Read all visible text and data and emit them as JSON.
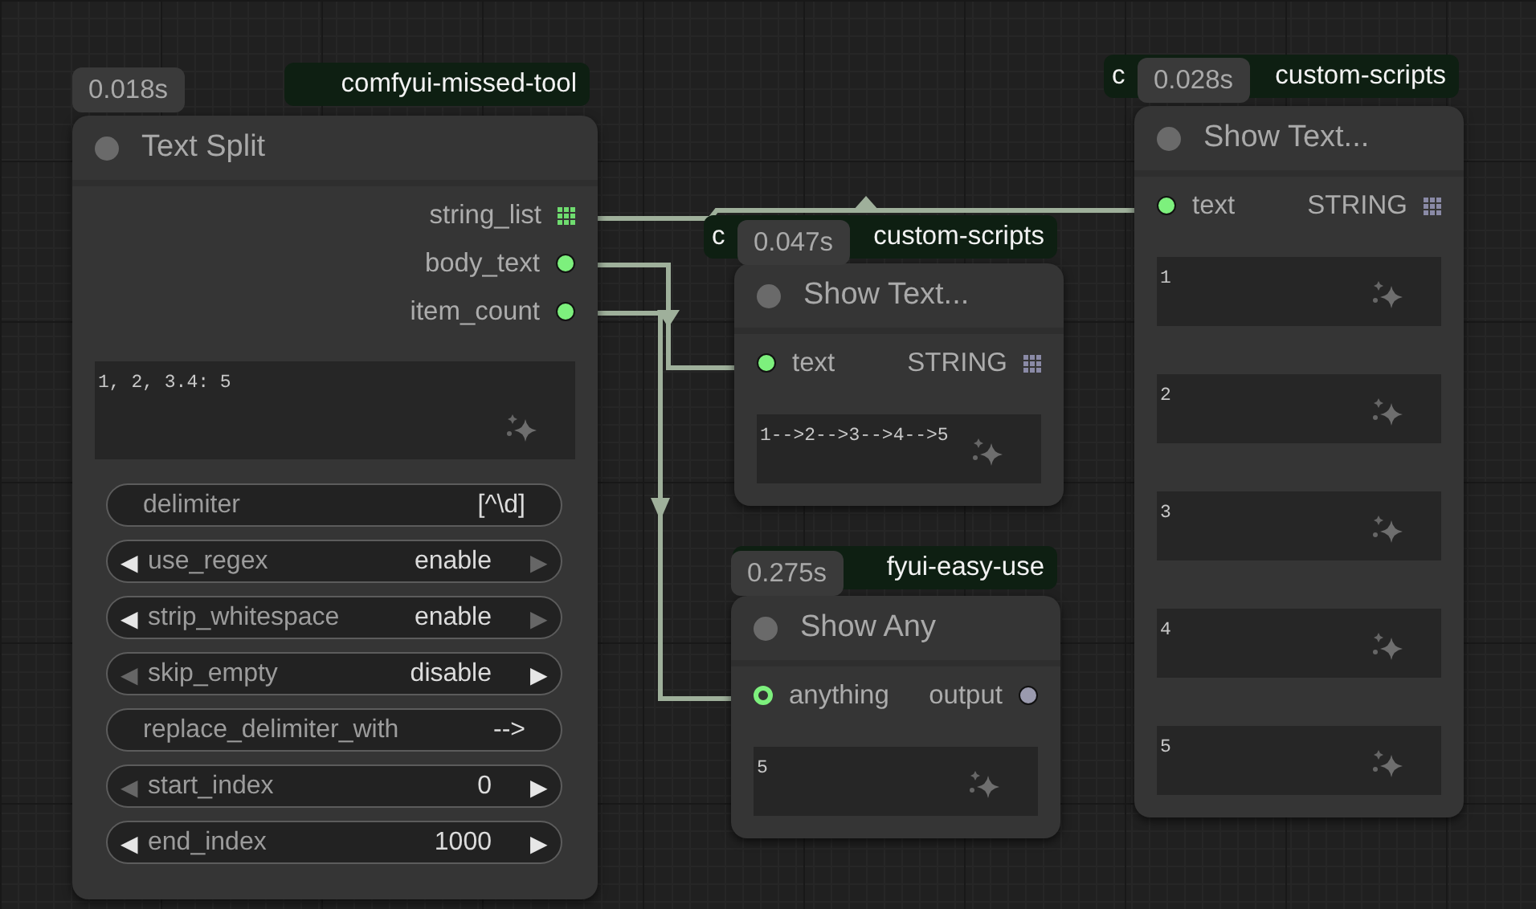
{
  "nodes": [
    {
      "title": "Text Split",
      "time": "0.018s",
      "source": [
        "comfyui-missed-tool"
      ],
      "outputs": [
        {
          "label": "string_list",
          "kind": "grid",
          "color": "#6fdc6f"
        },
        {
          "label": "body_text",
          "kind": "dot",
          "color": "#7df07d"
        },
        {
          "label": "item_count",
          "kind": "dot",
          "color": "#7df07d"
        }
      ],
      "textareas": [
        "1, 2, 3.4: 5"
      ],
      "widgets": [
        {
          "kind": "text",
          "label": "delimiter",
          "value": "[^\\d]"
        },
        {
          "kind": "combo",
          "label": "use_regex",
          "value": "enable",
          "prev": "◀",
          "next": "▶",
          "prev_enabled": true,
          "next_enabled": false
        },
        {
          "kind": "combo",
          "label": "strip_whitespace",
          "value": "enable",
          "prev": "◀",
          "next": "▶",
          "prev_enabled": true,
          "next_enabled": false
        },
        {
          "kind": "combo",
          "label": "skip_empty",
          "value": "disable",
          "prev": "◀",
          "next": "▶",
          "prev_enabled": false,
          "next_enabled": true
        },
        {
          "kind": "text",
          "label": "replace_delimiter_with",
          "value": "-->"
        },
        {
          "kind": "combo",
          "label": "start_index",
          "value": "0",
          "prev": "◀",
          "next": "▶",
          "prev_enabled": false,
          "next_enabled": true
        },
        {
          "kind": "combo",
          "label": "end_index",
          "value": "1000",
          "prev": "◀",
          "next": "▶",
          "prev_enabled": true,
          "next_enabled": true
        }
      ]
    },
    {
      "title": "Show Text...",
      "time": "0.047s",
      "source": [
        "c",
        "custom-scripts"
      ],
      "inputs": [
        {
          "label": "text",
          "kind": "dot",
          "color": "#7df07d"
        }
      ],
      "outputs": [
        {
          "label": "STRING",
          "kind": "grid",
          "color": "#8a8aa6"
        }
      ],
      "textareas": [
        "1-->2-->3-->4-->5"
      ]
    },
    {
      "title": "Show Any",
      "time": "0.275s",
      "source": [
        "fyui-easy-use"
      ],
      "inputs": [
        {
          "label": "anything",
          "kind": "ring",
          "color": "#7df07d"
        }
      ],
      "outputs": [
        {
          "label": "output",
          "kind": "dot",
          "color": "#9a9aae"
        }
      ],
      "textareas": [
        "5"
      ]
    },
    {
      "title": "Show Text...",
      "time": "0.028s",
      "source": [
        "c",
        "custom-scripts"
      ],
      "inputs": [
        {
          "label": "text",
          "kind": "dot",
          "color": "#7df07d"
        }
      ],
      "outputs": [
        {
          "label": "STRING",
          "kind": "grid",
          "color": "#8a8aa6"
        }
      ],
      "textareas": [
        "1",
        "2",
        "3",
        "4",
        "5"
      ]
    }
  ]
}
